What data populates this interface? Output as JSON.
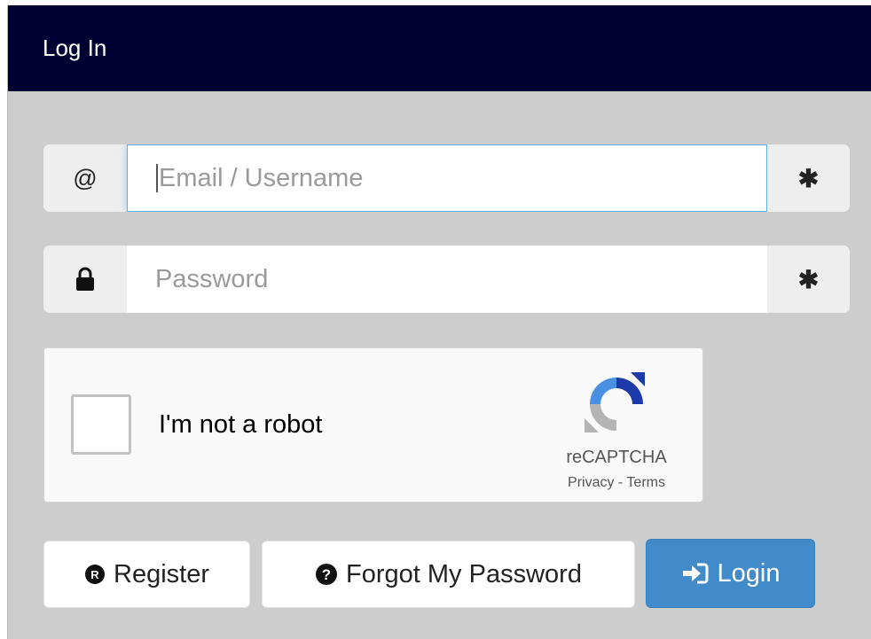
{
  "header": {
    "title": "Log In"
  },
  "email": {
    "addon": "@",
    "placeholder": "Email / Username",
    "required_mark": "✱"
  },
  "password": {
    "placeholder": "Password",
    "required_mark": "✱"
  },
  "recaptcha": {
    "label": "I'm not a robot",
    "brand": "reCAPTCHA",
    "links": "Privacy - Terms"
  },
  "buttons": {
    "register": "Register",
    "forgot": "Forgot My Password",
    "login": "Login"
  },
  "icons": {
    "email": "at-sign-icon",
    "password": "lock-icon",
    "required": "asterisk-icon",
    "register": "registered-icon",
    "forgot": "question-circle-icon",
    "login": "sign-in-icon"
  },
  "colors": {
    "header_bg": "#000033",
    "panel_bg": "#cdcdcd",
    "primary": "#428bca"
  }
}
